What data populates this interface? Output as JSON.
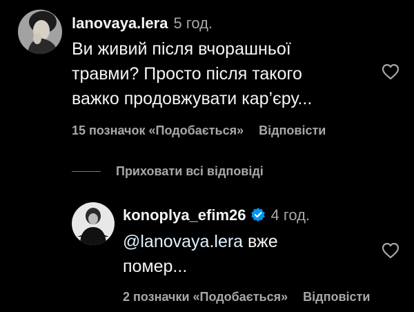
{
  "comment": {
    "username": "lanovaya.lera",
    "time": "5 год.",
    "text": "Ви живий після вчорашньої\nтравми? Просто після такого\nважко продовжувати кар’єру...",
    "likes": "15 позначок «Подобається»",
    "reply_label": "Відповісти"
  },
  "replies_toggle": {
    "label": "Приховати всі відповіді"
  },
  "reply": {
    "username": "konoplya_efim26",
    "time": "4 год.",
    "mention": "@lanovaya.lera",
    "text_rest": " вже\nпомер...",
    "likes": "2 позначки «Подобається»",
    "reply_label": "Відповісти"
  },
  "colors": {
    "background": "#000000",
    "primary_text": "#f5f5f5",
    "secondary_text": "#a8a8a8",
    "mention": "#e0f1ff",
    "verified": "#0095f6"
  },
  "icons": {
    "like": "heart-outline-icon",
    "verified": "verified-badge-icon"
  }
}
